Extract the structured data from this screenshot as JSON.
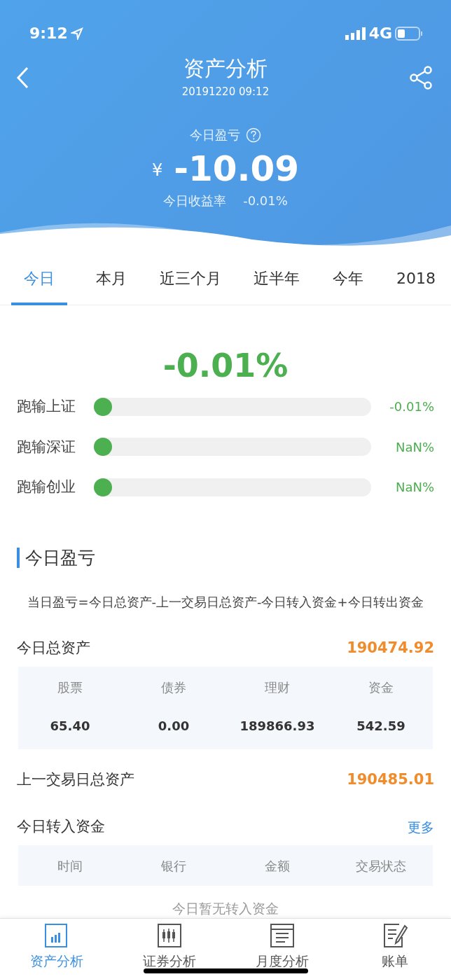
{
  "status_bar": {
    "time": "9:12",
    "network": "4G"
  },
  "header": {
    "title": "资产分析",
    "subtitle": "20191220 09:12",
    "pnl_label": "今日盈亏",
    "currency": "¥",
    "pnl_value": "-10.09",
    "rate_label": "今日收益率",
    "rate_value": "-0.01%"
  },
  "period_tabs": [
    {
      "label": "今日",
      "selected": true
    },
    {
      "label": "本月",
      "selected": false
    },
    {
      "label": "近三个月",
      "selected": false
    },
    {
      "label": "近半年",
      "selected": false
    },
    {
      "label": "今年",
      "selected": false
    },
    {
      "label": "2018",
      "selected": false
    }
  ],
  "summary": {
    "percent": "-0.01%"
  },
  "comparisons": [
    {
      "label": "跑输上证",
      "level": 0,
      "reading": "-0.01%"
    },
    {
      "label": "跑输深证",
      "level": 0,
      "reading": "NaN%"
    },
    {
      "label": "跑输创业",
      "level": 0,
      "reading": "NaN%"
    }
  ],
  "section": {
    "title": "今日盈亏",
    "formula": "当日盈亏=今日总资产-上一交易日总资产-今日转入资金+今日转出资金"
  },
  "total_assets": {
    "label": "今日总资产",
    "value": "190474.92",
    "columns": [
      "股票",
      "债券",
      "理财",
      "资金"
    ],
    "values": [
      "65.40",
      "0.00",
      "189866.93",
      "542.59"
    ]
  },
  "previous_assets": {
    "label": "上一交易日总资产",
    "value": "190485.01"
  },
  "transfers": {
    "label": "今日转入资金",
    "more": "更多",
    "columns": [
      "时间",
      "银行",
      "金额",
      "交易状态"
    ],
    "empty": "今日暂无转入资金"
  },
  "bottom_tabs": [
    {
      "label": "资产分析",
      "kind": "chart",
      "selected": true
    },
    {
      "label": "证券分析",
      "kind": "candles",
      "selected": false
    },
    {
      "label": "月度分析",
      "kind": "calendar",
      "selected": false
    },
    {
      "label": "账单",
      "kind": "bill",
      "selected": false
    }
  ]
}
